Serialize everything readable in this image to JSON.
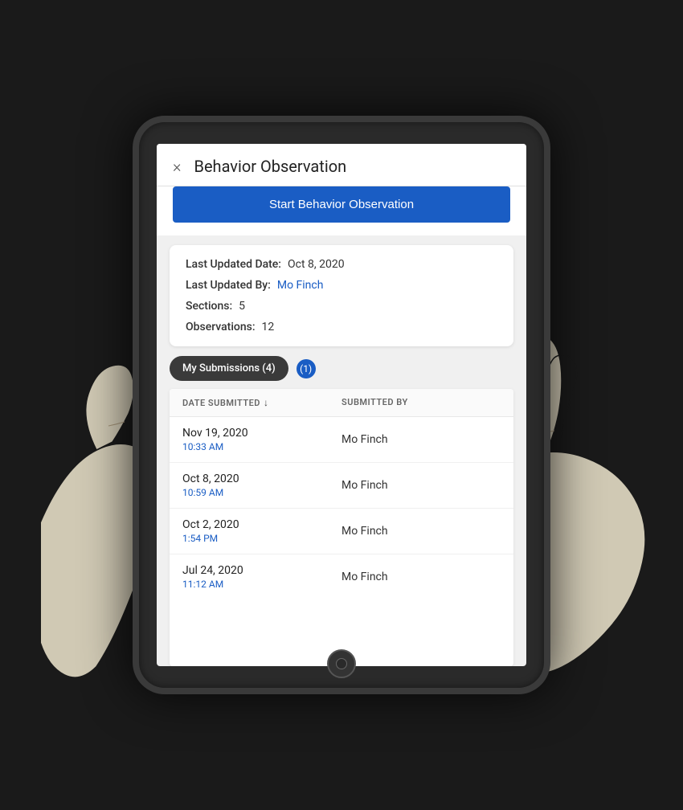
{
  "page": {
    "background": "#1a1a1a"
  },
  "modal": {
    "title": "Behavior Observation",
    "close_label": "×",
    "start_button_label": "Start Behavior Observation"
  },
  "info_card": {
    "last_updated_date_label": "Last Updated Date:",
    "last_updated_date_value": "Oct 8, 2020",
    "last_updated_by_label": "Last Updated By:",
    "last_updated_by_value": "Mo Finch",
    "sections_label": "Sections:",
    "sections_value": "5",
    "observations_label": "Observations:",
    "observations_value": "12"
  },
  "tabs": {
    "my_submissions_label": "My Submissions (4)",
    "other_tab_label": "(1)"
  },
  "table": {
    "col1_header": "DATE SUBMITTED",
    "col2_header": "SUBMITTED BY",
    "rows": [
      {
        "date": "Nov 19, 2020",
        "time": "10:33 AM",
        "submitted_by": "Mo Finch"
      },
      {
        "date": "Oct 8, 2020",
        "time": "10:59 AM",
        "submitted_by": "Mo Finch"
      },
      {
        "date": "Oct 2, 2020",
        "time": "1:54 PM",
        "submitted_by": "Mo Finch"
      },
      {
        "date": "Jul 24, 2020",
        "time": "11:12 AM",
        "submitted_by": "Mo Finch"
      }
    ]
  }
}
